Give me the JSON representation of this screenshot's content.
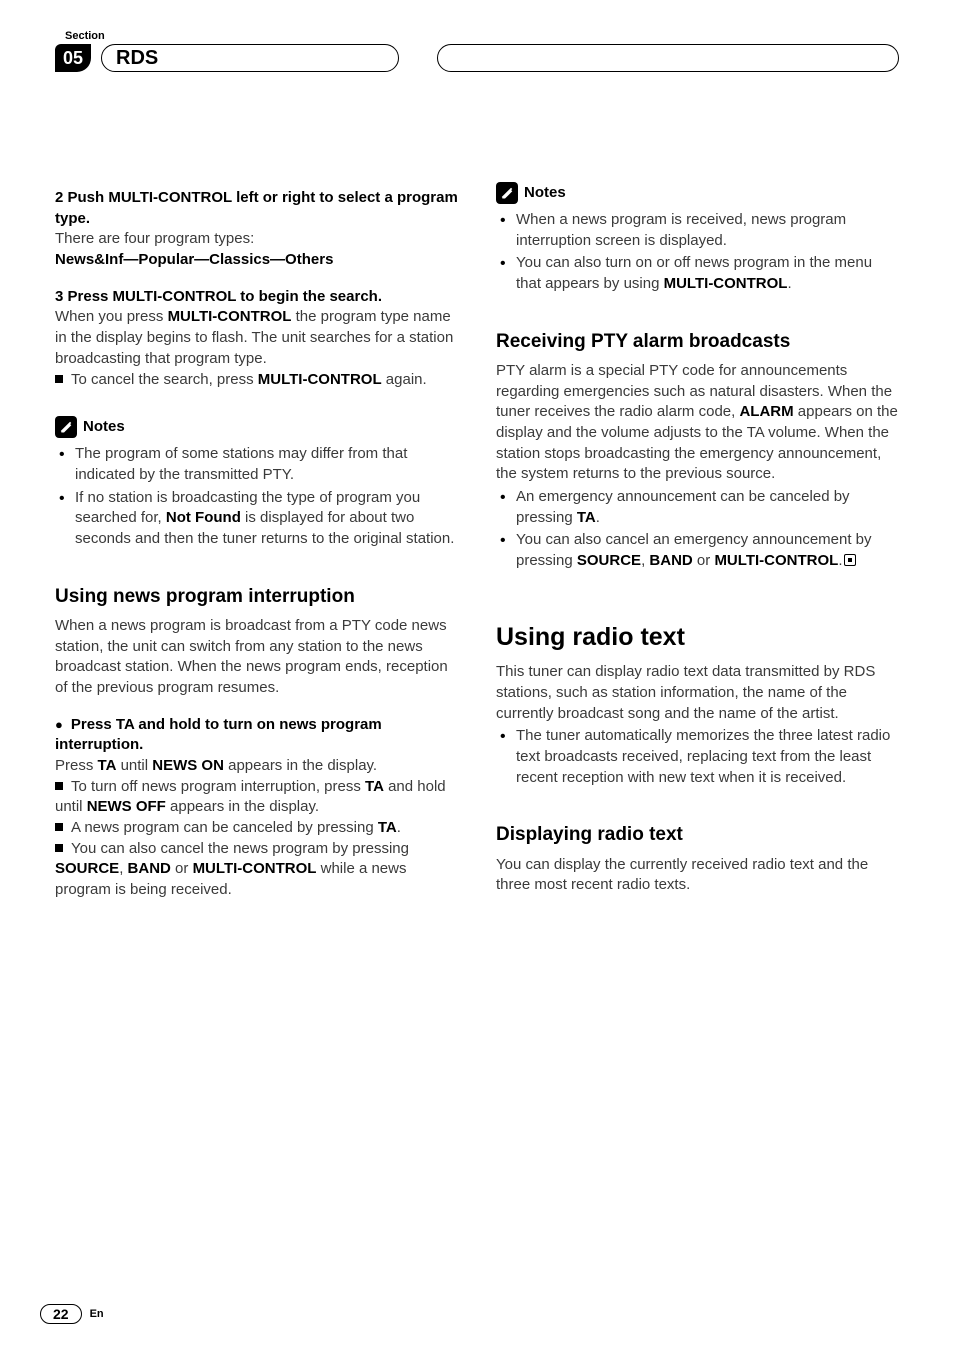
{
  "header": {
    "section_label": "Section",
    "chapter_number": "05",
    "chapter_title": "RDS"
  },
  "left": {
    "step2_head": "2   Push MULTI-CONTROL left or right to select a program type.",
    "step2_body1": "There are four program types:",
    "step2_types": "News&Inf—Popular—Classics—Others",
    "step3_head": "3   Press MULTI-CONTROL to begin the search.",
    "step3_body_a": "When you press ",
    "step3_body_b": "MULTI-CONTROL",
    "step3_body_c": " the program type name in the display begins to flash. The unit searches for a station broadcasting that program type.",
    "step3_sub_a": "To cancel the search, press ",
    "step3_sub_b": "MULTI-CONTROL",
    "step3_sub_c": " again.",
    "notes_label": "Notes",
    "note1": "The program of some stations may differ from that indicated by the transmitted PTY.",
    "note2_a": "If no station is broadcasting the type of program you searched for, ",
    "note2_b": "Not Found",
    "note2_c": " is displayed for about two seconds and then the tuner returns to the original station.",
    "h_news": "Using news program interruption",
    "news_intro": "When a news program is broadcast from a PTY code news station, the unit can switch from any station to the news broadcast station. When the news program ends, reception of the previous program resumes.",
    "news_step_head": "Press TA and hold to turn on news program interruption.",
    "news_step_a": "Press ",
    "news_step_b": "TA",
    "news_step_c": " until ",
    "news_step_d": "NEWS ON",
    "news_step_e": " appears in the display.",
    "news_sub1_a": "To turn off news program interruption, press ",
    "news_sub1_b": "TA",
    "news_sub1_c": " and hold until ",
    "news_sub1_d": "NEWS OFF",
    "news_sub1_e": " appears in the display.",
    "news_sub2_a": "A news program can be canceled by pressing ",
    "news_sub2_b": "TA",
    "news_sub2_c": ".",
    "news_sub3_a": "You can also cancel the news program by pressing ",
    "news_sub3_b": "SOURCE",
    "news_sub3_c": ", ",
    "news_sub3_d": "BAND",
    "news_sub3_e": " or ",
    "news_sub3_f": "MULTI-CONTROL",
    "news_sub3_g": " while a news program is being received."
  },
  "right": {
    "notes_label": "Notes",
    "rnote1": "When a news program is received, news program interruption screen is displayed.",
    "rnote2_a": "You can also turn on or off news program in the menu that appears by using ",
    "rnote2_b": "MULTI-CONTROL",
    "rnote2_c": ".",
    "h_pty": "Receiving PTY alarm broadcasts",
    "pty_a": "PTY alarm is a special PTY code for announcements regarding emergencies such as natural disasters. When the tuner receives the radio alarm code, ",
    "pty_b": "ALARM",
    "pty_c": " appears on the display and the volume adjusts to the TA volume. When the station stops broadcasting the emergency announcement, the system returns to the previous source.",
    "pty_li1_a": "An emergency announcement can be canceled by pressing ",
    "pty_li1_b": "TA",
    "pty_li1_c": ".",
    "pty_li2_a": "You can also cancel an emergency announcement by pressing ",
    "pty_li2_b": "SOURCE",
    "pty_li2_c": ", ",
    "pty_li2_d": "BAND",
    "pty_li2_e": " or ",
    "pty_li2_f": "MULTI-CONTROL",
    "pty_li2_g": ".",
    "h_radio": "Using radio text",
    "radio_intro": "This tuner can display radio text data transmitted by RDS stations, such as station information, the name of the currently broadcast song and the name of the artist.",
    "radio_li1": "The tuner automatically memorizes the three latest radio text broadcasts received, replacing text from the least recent reception with new text when it is received.",
    "h_display": "Displaying radio text",
    "display_body": "You can display the currently received radio text and the three most recent radio texts."
  },
  "footer": {
    "page": "22",
    "lang": "En"
  }
}
